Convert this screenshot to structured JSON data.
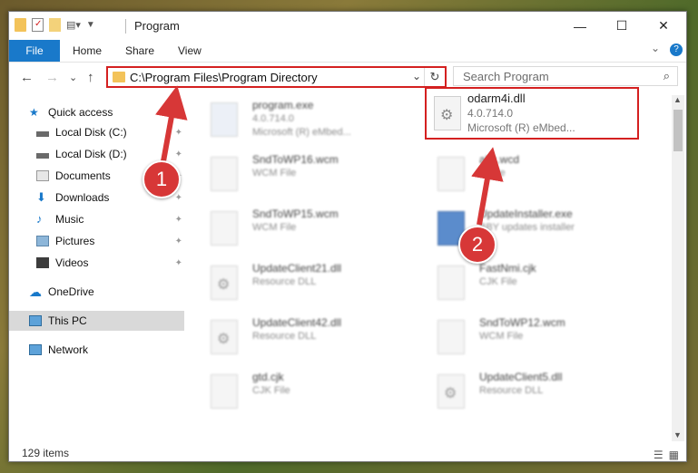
{
  "window": {
    "title": "Program",
    "controls": {
      "minimize": "—",
      "maximize": "☐",
      "close": "✕"
    }
  },
  "ribbon": {
    "file": "File",
    "tabs": [
      "Home",
      "Share",
      "View"
    ],
    "help": "?",
    "expand": "⌄"
  },
  "address": {
    "path": "C:\\Program Files\\Program Directory",
    "dropdown": "⌄",
    "refresh": "↻"
  },
  "search": {
    "placeholder": "Search Program",
    "icon": "search-icon"
  },
  "nav": {
    "back": "←",
    "forward": "→",
    "recent": "⌄",
    "up": "↑"
  },
  "sidebar": {
    "items": [
      {
        "label": "Quick access",
        "icon": "star-icon",
        "pinned": false
      },
      {
        "label": "Local Disk (C:)",
        "icon": "drive-icon",
        "pinned": true
      },
      {
        "label": "Local Disk (D:)",
        "icon": "drive-icon",
        "pinned": true
      },
      {
        "label": "Documents",
        "icon": "documents-icon",
        "pinned": true
      },
      {
        "label": "Downloads",
        "icon": "download-icon",
        "pinned": true
      },
      {
        "label": "Music",
        "icon": "music-icon",
        "pinned": true
      },
      {
        "label": "Pictures",
        "icon": "pictures-icon",
        "pinned": true
      },
      {
        "label": "Videos",
        "icon": "videos-icon",
        "pinned": true
      },
      {
        "label": "OneDrive",
        "icon": "cloud-icon",
        "pinned": false
      },
      {
        "label": "This PC",
        "icon": "computer-icon",
        "pinned": false,
        "selected": true
      },
      {
        "label": "Network",
        "icon": "network-icon",
        "pinned": false
      }
    ],
    "pin_glyph": "📌"
  },
  "files": [
    {
      "name": "program.exe",
      "line2": "4.0.714.0",
      "line3": "Microsoft (R) eMbed...",
      "icon": "exe-icon"
    },
    {
      "name": "SndToWP16.wcm",
      "line2": "WCM File",
      "line3": "",
      "icon": "file-icon"
    },
    {
      "name": "abc.wcd",
      "line2": "D File",
      "line3": "",
      "icon": "file-icon"
    },
    {
      "name": "SndToWP15.wcm",
      "line2": "WCM File",
      "line3": "",
      "icon": "file-icon"
    },
    {
      "name": "UpdateInstaller.exe",
      "line2": "BBY updates installer",
      "line3": "",
      "icon": "installer-icon"
    },
    {
      "name": "UpdateClient21.dll",
      "line2": "Resource DLL",
      "line3": "",
      "icon": "dll-icon"
    },
    {
      "name": "FastNmi.cjk",
      "line2": "CJK File",
      "line3": "",
      "icon": "file-icon"
    },
    {
      "name": "UpdateClient42.dll",
      "line2": "Resource DLL",
      "line3": "",
      "icon": "dll-icon"
    },
    {
      "name": "SndToWP12.wcm",
      "line2": "WCM File",
      "line3": "",
      "icon": "file-icon"
    },
    {
      "name": "gtd.cjk",
      "line2": "CJK File",
      "line3": "",
      "icon": "file-icon"
    },
    {
      "name": "UpdateClient5.dll",
      "line2": "Resource DLL",
      "line3": "",
      "icon": "dll-icon"
    }
  ],
  "highlighted_file": {
    "name": "odarm4i.dll",
    "line2": "4.0.714.0",
    "line3": "Microsoft (R) eMbed...",
    "icon": "dll-icon"
  },
  "annotations": {
    "badge1": "1",
    "badge2": "2",
    "color": "#d73737"
  },
  "status": {
    "count": "129 items"
  }
}
